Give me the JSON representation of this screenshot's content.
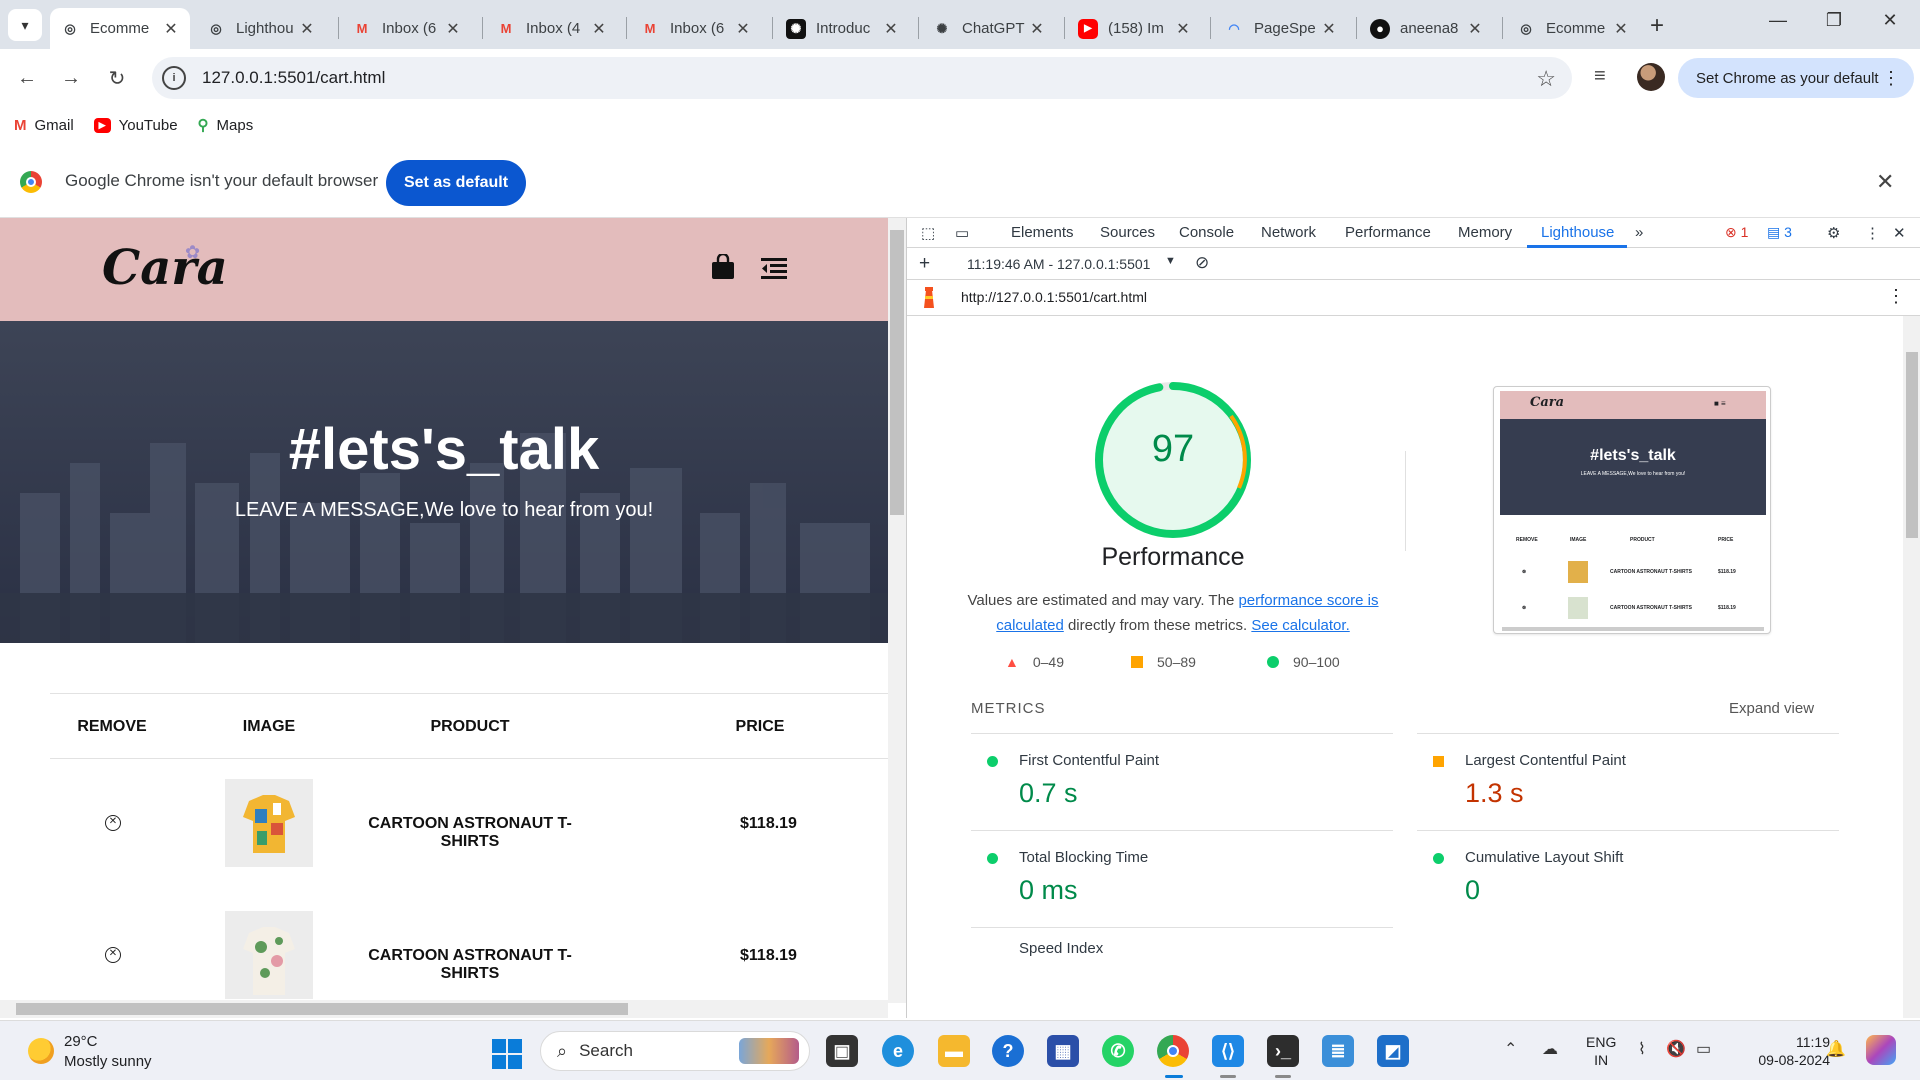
{
  "browser": {
    "tabs": [
      {
        "title": "Ecomme",
        "icon": "globe-icon",
        "active": true
      },
      {
        "title": "Lighthou",
        "icon": "globe-icon"
      },
      {
        "title": "Inbox (6",
        "icon": "gmail-icon"
      },
      {
        "title": "Inbox (4",
        "icon": "gmail-icon"
      },
      {
        "title": "Inbox (6",
        "icon": "gmail-icon"
      },
      {
        "title": "Introduc",
        "icon": "openai-icon"
      },
      {
        "title": "ChatGPT",
        "icon": "openai-icon"
      },
      {
        "title": "(158) Im",
        "icon": "youtube-icon"
      },
      {
        "title": "PageSpe",
        "icon": "pagespeed-icon"
      },
      {
        "title": "aneena8",
        "icon": "github-icon"
      },
      {
        "title": "Ecomme",
        "icon": "globe-icon"
      }
    ],
    "url": "127.0.0.1:5501/cart.html",
    "default_button": "Set Chrome as your default",
    "bookmarks": [
      {
        "label": "Gmail",
        "icon": "gmail-icon"
      },
      {
        "label": "YouTube",
        "icon": "youtube-icon"
      },
      {
        "label": "Maps",
        "icon": "maps-icon"
      }
    ],
    "infobar": {
      "message": "Google Chrome isn't your default browser",
      "button": "Set as default"
    }
  },
  "page": {
    "logo": "Cara",
    "hero_title": "#lets's_talk",
    "hero_subtitle": "LEAVE A MESSAGE,We love to hear from you!",
    "table_headers": [
      "REMOVE",
      "IMAGE",
      "PRODUCT",
      "PRICE"
    ],
    "rows": [
      {
        "product": "CARTOON ASTRONAUT T-SHIRTS",
        "price": "$118.19"
      },
      {
        "product": "CARTOON ASTRONAUT T-SHIRTS",
        "price": "$118.19"
      }
    ]
  },
  "devtools": {
    "tabs": [
      "Elements",
      "Sources",
      "Console",
      "Network",
      "Performance",
      "Memory",
      "Lighthouse"
    ],
    "active_tab": "Lighthouse",
    "errors": "1",
    "messages": "3",
    "report_time": "11:19:46 AM - 127.0.0.1:5501",
    "report_url": "http://127.0.0.1:5501/cart.html",
    "score": 97,
    "score_title": "Performance",
    "desc_part1": "Values are estimated and may vary. The ",
    "desc_link1": "performance score is calculated",
    "desc_part2": " directly from these metrics. ",
    "desc_link2": "See calculator.",
    "legend": [
      "0–49",
      "50–89",
      "90–100"
    ],
    "metrics_title": "METRICS",
    "expand_view": "Expand view",
    "metrics": [
      {
        "label": "First Contentful Paint",
        "value": "0.7 s",
        "status": "pass"
      },
      {
        "label": "Largest Contentful Paint",
        "value": "1.3 s",
        "status": "average"
      },
      {
        "label": "Total Blocking Time",
        "value": "0 ms",
        "status": "pass"
      },
      {
        "label": "Cumulative Layout Shift",
        "value": "0",
        "status": "pass"
      },
      {
        "label": "Speed Index",
        "value": "",
        "status": "pass"
      }
    ],
    "thumb": {
      "logo": "Cara",
      "title": "#lets's_talk",
      "subtitle": "LEAVE A MESSAGE,We love to hear from you!",
      "headers": [
        "REMOVE",
        "IMAGE",
        "PRODUCT",
        "PRICE"
      ],
      "product": "CARTOON ASTRONAUT T-SHIRTS",
      "price": "$118.19"
    }
  },
  "taskbar": {
    "temp": "29°C",
    "weather": "Mostly sunny",
    "search_placeholder": "Search",
    "lang_line1": "ENG",
    "lang_line2": "IN",
    "time": "11:19",
    "date": "09-08-2024"
  },
  "colors": {
    "pass": "#0cce6b",
    "average": "#ffa400",
    "fail": "#ff4e42",
    "header_pink": "#e3bcbc",
    "accent_blue": "#1a73e8"
  }
}
